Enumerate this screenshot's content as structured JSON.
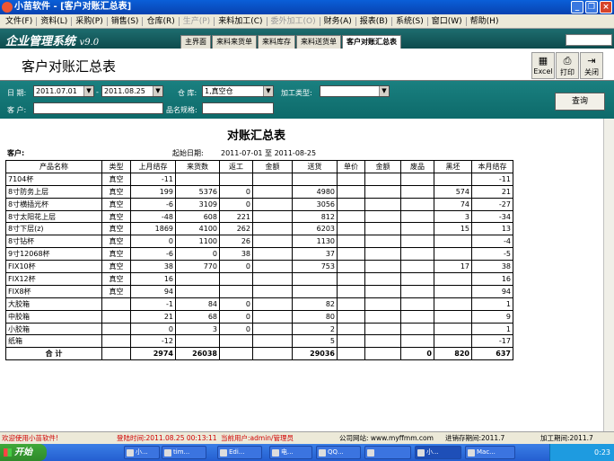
{
  "window": {
    "title": "小苗软件 - [客户对账汇总表]"
  },
  "menu": [
    "文件(F)",
    "资料(L)",
    "采购(P)",
    "销售(S)",
    "仓库(R)",
    "生产(P)",
    "来料加工(C)",
    "委外加工(O)",
    "财务(A)",
    "报表(B)",
    "系统(S)",
    "窗口(W)",
    "帮助(H)"
  ],
  "brand": {
    "name": "企业管理系统",
    "version": "v9.0"
  },
  "tabs": [
    "主界面",
    "来料来货单",
    "来料库存",
    "来料送货单",
    "客户对账汇总表"
  ],
  "header": {
    "title": "客户对账汇总表",
    "excel": "Excel",
    "print": "打印",
    "close": "关闭"
  },
  "filters": {
    "date_label": "日 期:",
    "date_from": "2011.07.01",
    "dash": "-",
    "date_to": "2011.08.25",
    "warehouse_label": "仓 库:",
    "warehouse": "1,真空仓",
    "process_label": "加工类型:",
    "process": "",
    "customer_label": "客 户:",
    "customer": "",
    "spec_label": "品名规格:",
    "spec": "",
    "query": "查询"
  },
  "report": {
    "title": "对账汇总表",
    "customer_label": "客户:",
    "period_label": "起始日期:",
    "period": "2011-07-01 至 2011-08-25",
    "headers": [
      "产品名称",
      "类型",
      "上月结存",
      "来货数",
      "返工",
      "金额",
      "送货",
      "单价",
      "金额",
      "废品",
      "黑坯",
      "本月结存"
    ],
    "rows": [
      [
        "7104杯",
        "真空",
        "-11",
        "",
        "",
        "",
        "",
        "",
        "",
        "",
        "",
        "-11"
      ],
      [
        "8寸防务上层",
        "真空",
        "199",
        "5376",
        "0",
        "",
        "4980",
        "",
        "",
        "",
        "574",
        "21"
      ],
      [
        "8寸横插光杯",
        "真空",
        "-6",
        "3109",
        "0",
        "",
        "3056",
        "",
        "",
        "",
        "74",
        "-27"
      ],
      [
        "8寸太阳花上层",
        "真空",
        "-48",
        "608",
        "221",
        "",
        "812",
        "",
        "",
        "",
        "3",
        "-34"
      ],
      [
        "8寸下层(z)",
        "真空",
        "1869",
        "4100",
        "262",
        "",
        "6203",
        "",
        "",
        "",
        "15",
        "13"
      ],
      [
        "8寸钻杯",
        "真空",
        "0",
        "1100",
        "26",
        "",
        "1130",
        "",
        "",
        "",
        "",
        "-4"
      ],
      [
        "9寸12068杯",
        "真空",
        "-6",
        "0",
        "38",
        "",
        "37",
        "",
        "",
        "",
        "",
        "-5"
      ],
      [
        "FIX10杯",
        "真空",
        "38",
        "770",
        "0",
        "",
        "753",
        "",
        "",
        "",
        "17",
        "38"
      ],
      [
        "FIX12杯",
        "真空",
        "16",
        "",
        "",
        "",
        "",
        "",
        "",
        "",
        "",
        "16"
      ],
      [
        "FIX8杯",
        "真空",
        "94",
        "",
        "",
        "",
        "",
        "",
        "",
        "",
        "",
        "94"
      ],
      [
        "大胶箱",
        "",
        "-1",
        "84",
        "0",
        "",
        "82",
        "",
        "",
        "",
        "",
        "1"
      ],
      [
        "中胶箱",
        "",
        "21",
        "68",
        "0",
        "",
        "80",
        "",
        "",
        "",
        "",
        "9"
      ],
      [
        "小胶箱",
        "",
        "0",
        "3",
        "0",
        "",
        "2",
        "",
        "",
        "",
        "",
        "1"
      ],
      [
        "纸箱",
        "",
        "-12",
        "",
        "",
        "",
        "5",
        "",
        "",
        "",
        "",
        "-17"
      ]
    ],
    "total": [
      "合 计",
      "",
      "2974",
      "26038",
      "",
      "",
      "29036",
      "",
      "",
      "0",
      "820",
      "637"
    ]
  },
  "status": {
    "welcome": "欢迎使用小苗软件!",
    "login": "登陆时间:2011.08.25 00:13:11",
    "user": "当前用户:admin/管理员",
    "site": "公司网站: www.myffmm.com",
    "stock_period": "进销存期间:2011.7",
    "proc_period": "加工期间:2011.7"
  },
  "taskbar": {
    "start": "开始",
    "items": [
      "小...",
      "tim...",
      "Edi...",
      "电...",
      "QQ...",
      "",
      "小...",
      "Mac..."
    ],
    "clock": "0:23"
  }
}
